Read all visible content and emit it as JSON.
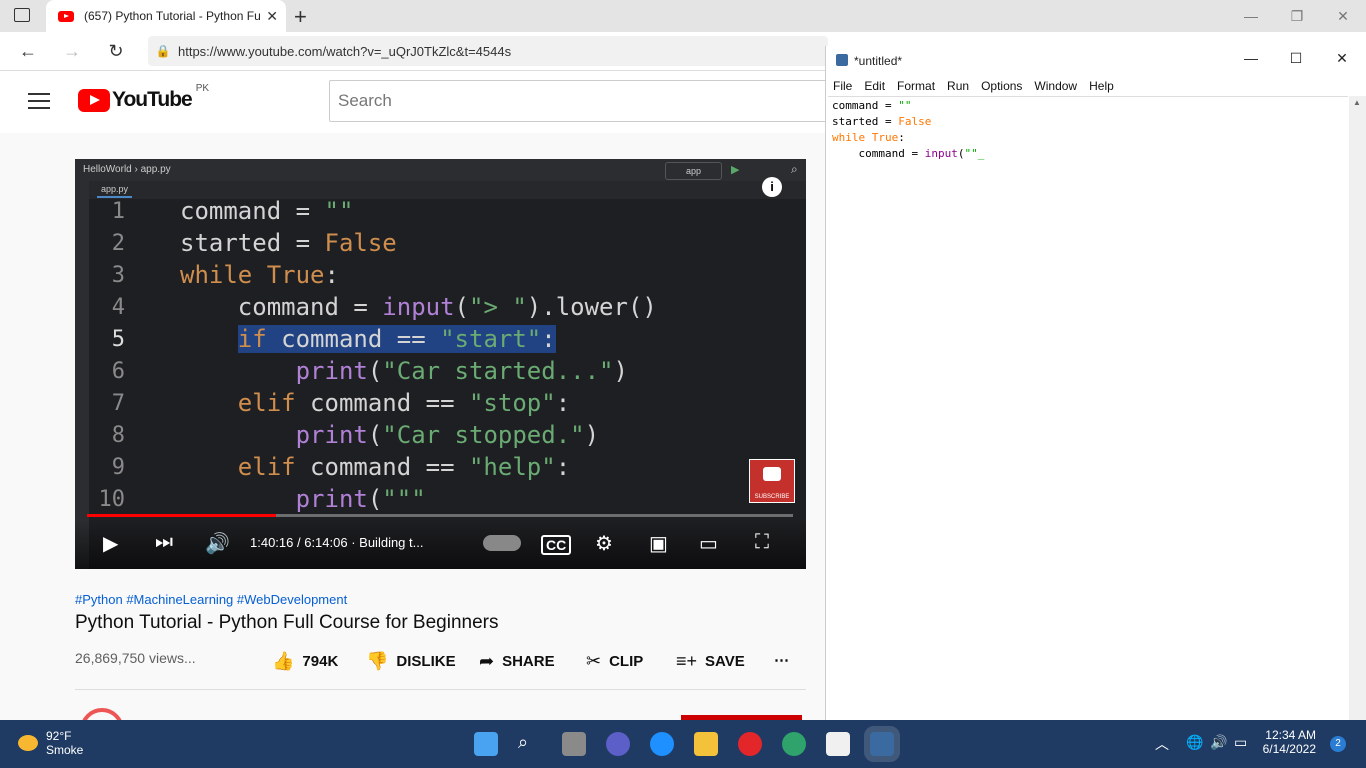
{
  "browser": {
    "tab_title": "(657) Python Tutorial - Python Fu",
    "url": "https://www.youtube.com/watch?v=_uQrJ0TkZlc&t=4544s"
  },
  "youtube": {
    "logo_text": "YouTube",
    "country": "PK",
    "search_placeholder": "Search",
    "video": {
      "ide_crumb": "HelloWorld › app.py",
      "ide_tab": "app.py",
      "run_config": "app",
      "code_lines": [
        {
          "num": "1",
          "text": "command = \"\""
        },
        {
          "num": "2",
          "text": "started = False"
        },
        {
          "num": "3",
          "text": "while True:"
        },
        {
          "num": "4",
          "text": "    command = input(\"> \").lower()"
        },
        {
          "num": "5",
          "text": "    if command == \"start\":"
        },
        {
          "num": "6",
          "text": "        print(\"Car started...\")"
        },
        {
          "num": "7",
          "text": "    elif command == \"stop\":"
        },
        {
          "num": "8",
          "text": "        print(\"Car stopped.\")"
        },
        {
          "num": "9",
          "text": "    elif command == \"help\":"
        },
        {
          "num": "10",
          "text": "        print(\"\"\""
        }
      ],
      "info_label": "i",
      "subscribe_label": "SUBSCRIBE",
      "time": "1:40:16 / 6:14:06",
      "chapter": "· Building t...",
      "progress": 0.268
    },
    "tags": "#Python #MachineLearning #WebDevelopment",
    "title": "Python Tutorial - Python Full Course for Beginners",
    "views": "26,869,750 views...",
    "actions": {
      "like": "794K",
      "dislike": "DISLIKE",
      "share": "SHARE",
      "clip": "CLIP",
      "save": "SAVE"
    }
  },
  "idle": {
    "title": "*untitled*",
    "menu": [
      "File",
      "Edit",
      "Format",
      "Run",
      "Options",
      "Window",
      "Help"
    ],
    "code": {
      "l1a": "command = ",
      "l1b": "\"\"",
      "l2a": "started = ",
      "l2b": "False",
      "l3a": "while",
      "l3b": " ",
      "l3c": "True",
      "l3d": ":",
      "l4a": "    command = ",
      "l4b": "input",
      "l4c": "(",
      "l4d": "\"\"_"
    }
  },
  "taskbar": {
    "temp": "92°F",
    "weather": "Smoke",
    "time": "12:34 AM",
    "date": "6/14/2022",
    "notifications": "2"
  }
}
